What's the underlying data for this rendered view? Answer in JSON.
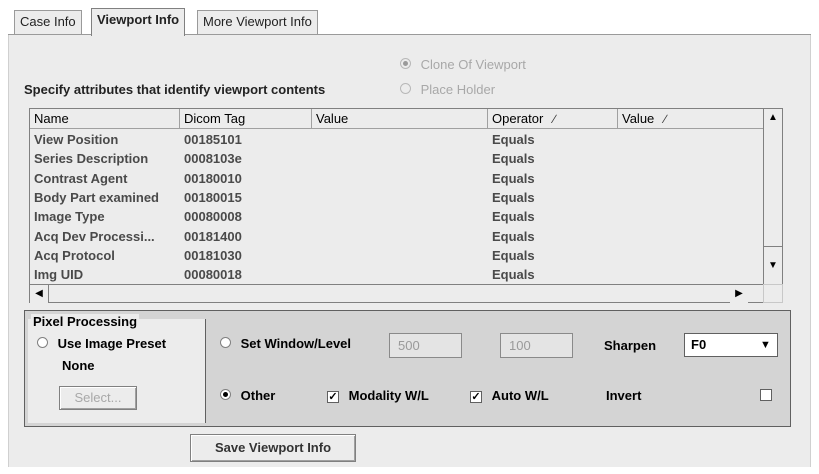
{
  "tabs": [
    {
      "label": "Case Info"
    },
    {
      "label": "Viewport Info"
    },
    {
      "label": "More Viewport Info"
    }
  ],
  "top_radios": {
    "clone_label": "Clone Of Viewport",
    "placeholder_label": "Place Holder",
    "clone_selected": true,
    "enabled": false
  },
  "specify_label": "Specify attributes that identify viewport contents",
  "table": {
    "columns": [
      "Name",
      "Dicom Tag",
      "Value",
      "Operator",
      "Value"
    ],
    "rows": [
      {
        "name": "View Position",
        "tag": "00185101",
        "value": "",
        "operator": "Equals",
        "value2": ""
      },
      {
        "name": "Series Description",
        "tag": "0008103e",
        "value": "",
        "operator": "Equals",
        "value2": ""
      },
      {
        "name": "Contrast Agent",
        "tag": "00180010",
        "value": "",
        "operator": "Equals",
        "value2": ""
      },
      {
        "name": "Body Part examined",
        "tag": "00180015",
        "value": "",
        "operator": "Equals",
        "value2": ""
      },
      {
        "name": "Image Type",
        "tag": "00080008",
        "value": "",
        "operator": "Equals",
        "value2": ""
      },
      {
        "name": "Acq Dev Processi...",
        "tag": "00181400",
        "value": "",
        "operator": "Equals",
        "value2": ""
      },
      {
        "name": "Acq Protocol",
        "tag": "00181030",
        "value": "",
        "operator": "Equals",
        "value2": ""
      },
      {
        "name": "Img UID",
        "tag": "00080018",
        "value": "",
        "operator": "Equals",
        "value2": ""
      }
    ]
  },
  "pixel_processing": {
    "title": "Pixel Processing",
    "use_image_preset_label": "Use Image Preset",
    "preset_value": "None",
    "select_button": "Select...",
    "set_window_level_label": "Set Window/Level",
    "window_value": "500",
    "level_value": "100",
    "sharpen_label": "Sharpen",
    "sharpen_value": "F0",
    "other_label": "Other",
    "other_selected": true,
    "modality_wl_label": "Modality W/L",
    "modality_wl_checked": true,
    "auto_wl_label": "Auto W/L",
    "auto_wl_checked": true,
    "invert_label": "Invert",
    "invert_checked": false
  },
  "save_button": "Save Viewport Info",
  "icons": {
    "edit": "pencil-icon",
    "up": "arrow-up-icon",
    "down": "arrow-down-icon",
    "left": "arrow-left-icon",
    "right": "arrow-right-icon",
    "dropdown": "chevron-down-icon",
    "check": "checkmark-icon"
  }
}
